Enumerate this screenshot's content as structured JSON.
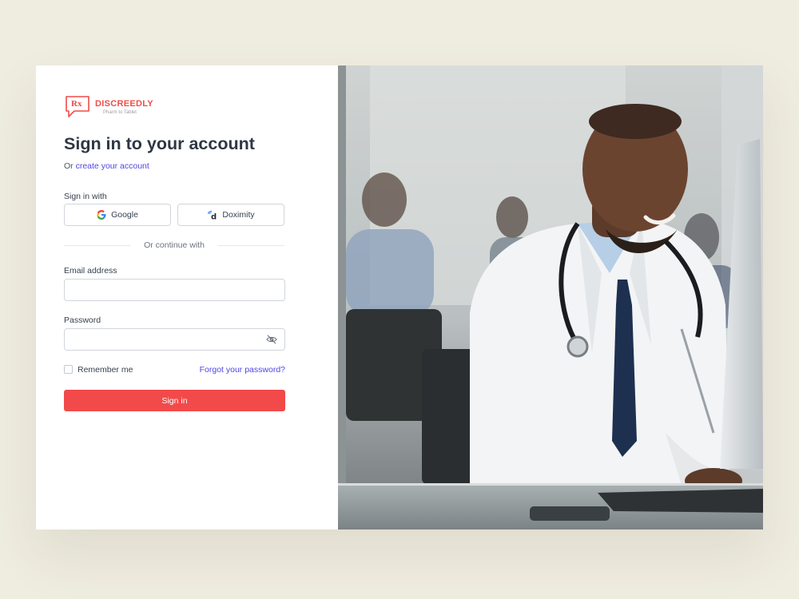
{
  "brand": {
    "name": "DISCREEDLY",
    "tagline": "Pharm to Tablet",
    "logo_mark": "Rx"
  },
  "heading": {
    "title": "Sign in to your account",
    "subtitle_prefix": "Or",
    "subtitle_link": "create your account"
  },
  "sso": {
    "label": "Sign in with",
    "google_label": "Google",
    "doximity_label": "Doximity"
  },
  "divider_text": "Or continue with",
  "fields": {
    "email_label": "Email address",
    "email_value": "",
    "password_label": "Password",
    "password_value": ""
  },
  "options": {
    "remember_label": "Remember me",
    "forgot_label": "Forgot your password?"
  },
  "submit_label": "Sign in",
  "colors": {
    "page_bg": "#efece0",
    "brand_red": "#ef4d48",
    "primary_button": "#f24a4a",
    "link": "#4f46e5"
  },
  "icons": {
    "google": "google-g-icon",
    "doximity": "doximity-logo-icon",
    "password_toggle": "eye-off-icon"
  }
}
